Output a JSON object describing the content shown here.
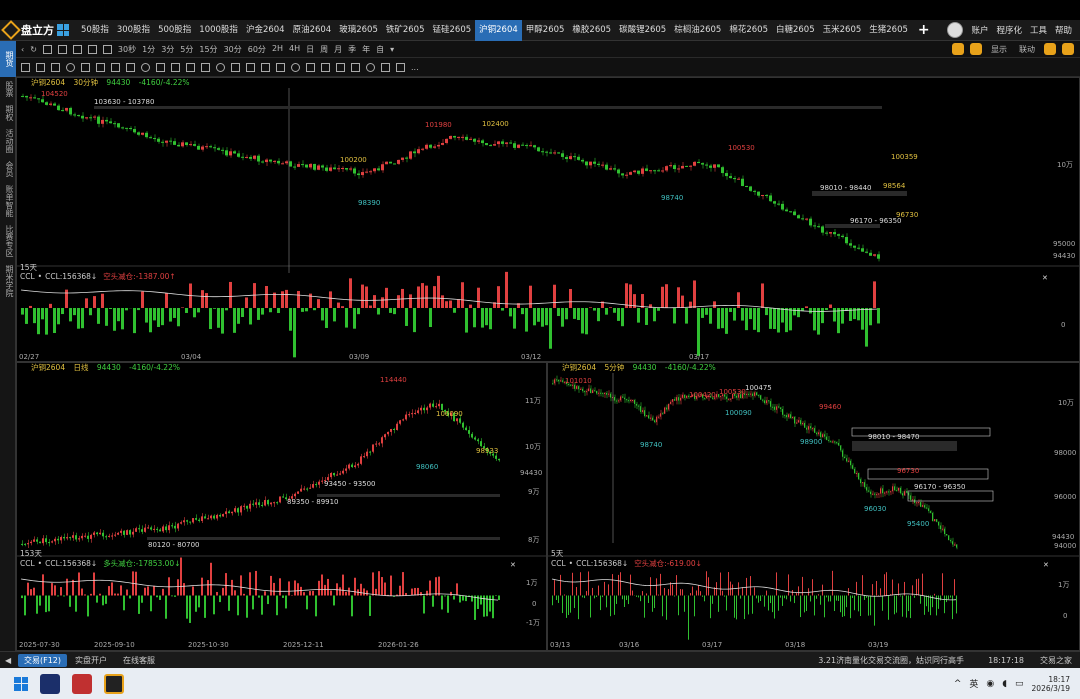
{
  "window": {
    "app_name": "盘立方",
    "tabs": [
      "50股指",
      "300股指",
      "500股指",
      "1000股指",
      "沪金2604",
      "原油2604",
      "玻璃2605",
      "铁矿2605",
      "锰硅2605",
      "沪铜2604",
      "甲醇2605",
      "橡胶2605",
      "碳酸锂2605",
      "棕榈油2605",
      "棉花2605",
      "白糖2605",
      "玉米2605",
      "生猪2605"
    ],
    "active_tab": "沪铜2604",
    "menu": [
      "账户",
      "程序化",
      "工具",
      "帮助"
    ]
  },
  "toolbar": {
    "periods": [
      "30秒",
      "1分",
      "3分",
      "5分",
      "15分",
      "30分",
      "60分",
      "2H",
      "4H",
      "日",
      "周",
      "月",
      "季",
      "年",
      "自"
    ],
    "right": [
      "显示",
      "联动"
    ]
  },
  "sidebar": [
    "期货",
    "股票",
    "期权",
    "活动圈",
    "会员",
    "账单智能",
    "比赛专区",
    "期米学院"
  ],
  "panel_main": {
    "symbol": "沪铜2604",
    "period": "30分钟",
    "price": "94430",
    "change": "-4160/-4.22%",
    "labels": {
      "high": "104520",
      "range1": "103630 - 103780",
      "p101980": "101980",
      "p102400": "102400",
      "p100200": "100200",
      "p98390": "98390",
      "p100530": "100530",
      "p100359": "100359",
      "p98740": "98740",
      "range2": "98010 - 98440",
      "p98564": "98564",
      "p96730": "96730",
      "range3": "96170 - 96350"
    },
    "yaxis": [
      "10万",
      "95000",
      "94430"
    ],
    "days": "15天",
    "sub": {
      "name": "CCL",
      "eq": "CCL:156368↓",
      "note": "空头减仓:-1387.00↑"
    },
    "dates": [
      "02/27",
      "03/04",
      "03/09",
      "03/12",
      "03/17"
    ]
  },
  "panel_daily": {
    "symbol": "沪铜2604",
    "period": "日线",
    "price": "94430",
    "change": "-4160/-4.22%",
    "labels": {
      "high": "114440",
      "p106090": "106090",
      "p98060": "98060",
      "p98933": "98933",
      "range1": "93450 - 93500",
      "range2": "89350 - 89910",
      "range3": "80120 - 80700"
    },
    "yaxis": [
      "11万",
      "10万",
      "94430",
      "9万",
      "8万"
    ],
    "days": "153天",
    "sub": {
      "name": "CCL",
      "eq": "CCL:156368↓",
      "note": "多头减仓:-17853.00↓"
    },
    "sub_yaxis": [
      "1万",
      "0",
      "-1万"
    ],
    "dates": [
      "2025-07-30",
      "2025-09-10",
      "2025-10-30",
      "2025-12-11",
      "2026-01-26"
    ]
  },
  "panel_5min": {
    "symbol": "沪铜2604",
    "period": "5分钟",
    "price": "94430",
    "change": "-4160/-4.22%",
    "labels": {
      "p101010": "101010",
      "p100420": "100420",
      "p100530": "100530",
      "p100475": "100475",
      "p100090": "100090",
      "p99460": "99460",
      "p98740": "98740",
      "p98900": "98900",
      "range1": "98010 - 98470",
      "p96730": "96730",
      "range2": "96170 - 96350",
      "p96030": "96030",
      "p95400": "95400"
    },
    "yaxis": [
      "10万",
      "98000",
      "96000",
      "94430",
      "94000"
    ],
    "days": "5天",
    "sub": {
      "name": "CCL",
      "eq": "CCL:156368↓",
      "note": "空头减仓:-619.00↓"
    },
    "sub_yaxis": [
      "1万",
      "0"
    ],
    "dates": [
      "03/13",
      "03/16",
      "03/17",
      "03/18",
      "03/19"
    ]
  },
  "statusbar": {
    "trade": "交易(F12)",
    "open": "实盘开户",
    "live": "在线客服",
    "news": "3.21济南量化交易交流圈，姑识同行高手",
    "time": "18:17:18",
    "brand": "交易之家"
  },
  "taskbar": {
    "ime": "英",
    "clock_time": "18:17",
    "clock_date": "2026/3/19"
  },
  "colors": {
    "up": "#e04040",
    "down": "#30c030",
    "accent": "#2a6db5",
    "label": "#e0c040"
  }
}
